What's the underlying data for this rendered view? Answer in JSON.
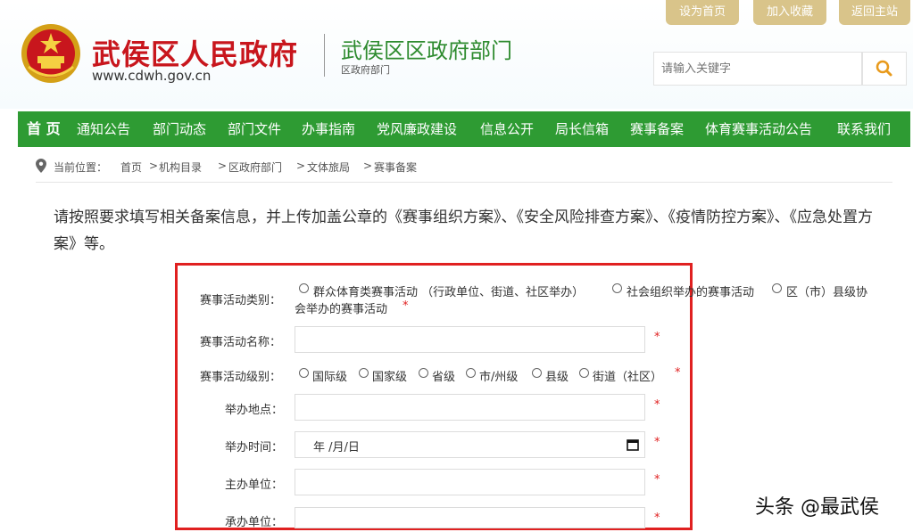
{
  "top_links": {
    "set_home": "设为首页",
    "add_favorite": "加入收藏",
    "back_main": "返回主站"
  },
  "site": {
    "title": "武侯区人民政府",
    "url": "www.cdwh.gov.cn",
    "dept_title": "武侯区区政府部门",
    "dept_sub": "区政府部门"
  },
  "search": {
    "placeholder": "请输入关键字",
    "icon": "search-icon"
  },
  "nav": {
    "items": [
      "首 页",
      "通知公告",
      "部门动态",
      "部门文件",
      "办事指南",
      "党风廉政建设",
      "信息公开",
      "局长信箱",
      "赛事备案",
      "体育赛事活动公告",
      "联系我们"
    ]
  },
  "breadcrumb": {
    "prefix": "当前位置：",
    "items": [
      "首页",
      "机构目录",
      "区政府部门",
      "文体旅局",
      "赛事备案"
    ],
    "sep": ">"
  },
  "intro": {
    "text": "请按照要求填写相关备案信息，并上传加盖公章的《赛事组织方案》、《安全风险排查方案》、《疫情防控方案》、《应急处置方案》等。"
  },
  "form": {
    "category_label": "赛事活动类别：",
    "category_options": [
      "群众体育类赛事活动 （行政单位、街道、社区举办）",
      "社会组织举办的赛事活动",
      "区（市）县级协",
      "会举办的赛事活动"
    ],
    "name_label": "赛事活动名称：",
    "level_label": "赛事活动级别：",
    "level_options": [
      "国际级",
      "国家级",
      "省级",
      "市/州级",
      "县级",
      "街道（社区）"
    ],
    "location_label": "举办地点：",
    "time_label": "举办时间：",
    "time_value": "年 /月/日",
    "host_label": "主办单位：",
    "organizer_label": "承办单位：",
    "required": "*"
  },
  "watermark": "头条 @最武侯",
  "colors": {
    "nav_green": "#2e9b33",
    "title_red": "#c8161d",
    "dept_green": "#2e8b2f",
    "gold": "#d9c48a",
    "frame_red": "#e02020"
  }
}
